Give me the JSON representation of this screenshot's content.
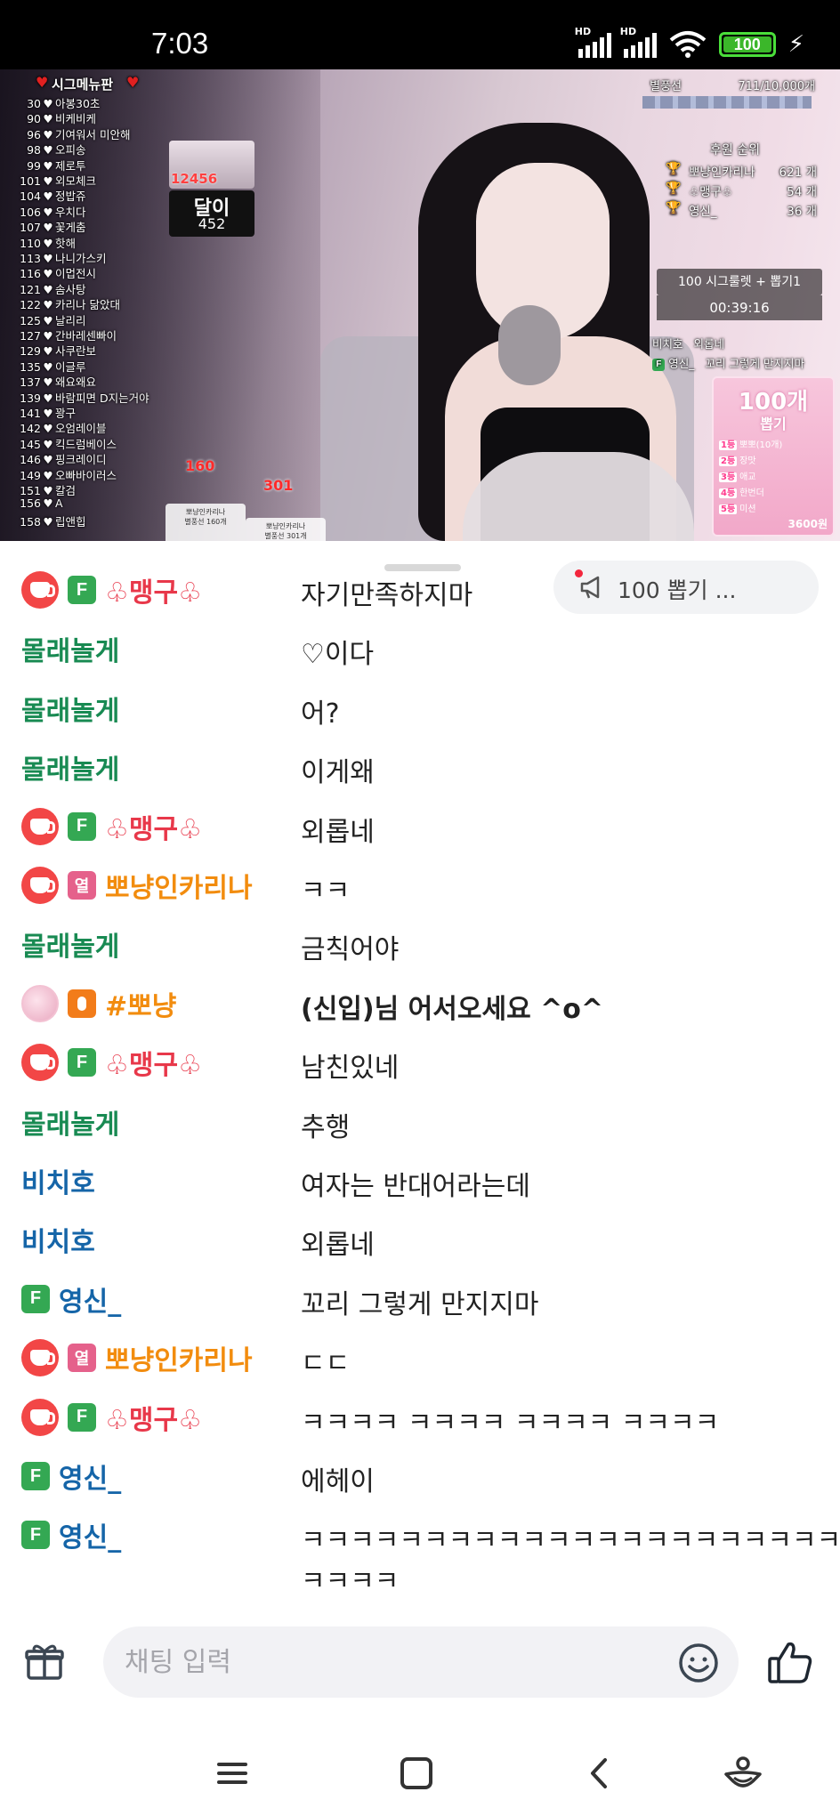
{
  "status_bar": {
    "time": "7:03",
    "hd1": "HD",
    "hd2": "HD",
    "battery": "100"
  },
  "video": {
    "sig_menu_title": "시그메뉴판",
    "sig_items": [
      {
        "num": "30",
        "name": "아봉30초"
      },
      {
        "num": "90",
        "name": "비케비케"
      },
      {
        "num": "96",
        "name": "기여워서 미안해"
      },
      {
        "num": "98",
        "name": "오피송"
      },
      {
        "num": "99",
        "name": "제로투"
      },
      {
        "num": "101",
        "name": "외모체크"
      },
      {
        "num": "104",
        "name": "정밥쥬"
      },
      {
        "num": "106",
        "name": "우치다"
      },
      {
        "num": "107",
        "name": "꽃게춤"
      },
      {
        "num": "110",
        "name": "핫해"
      },
      {
        "num": "113",
        "name": "나니가스키"
      },
      {
        "num": "116",
        "name": "이멉전시"
      },
      {
        "num": "121",
        "name": "솜사탕"
      },
      {
        "num": "122",
        "name": "카리나 닮았대"
      },
      {
        "num": "125",
        "name": "날리리"
      },
      {
        "num": "127",
        "name": "간바레센빠이"
      },
      {
        "num": "129",
        "name": "사쿠란보"
      },
      {
        "num": "135",
        "name": "이글루"
      },
      {
        "num": "137",
        "name": "왜요왜요"
      },
      {
        "num": "139",
        "name": "바람피면 D지는거야"
      },
      {
        "num": "141",
        "name": "꽝구"
      },
      {
        "num": "142",
        "name": "오엄레이블"
      },
      {
        "num": "145",
        "name": "킥드럼베이스"
      },
      {
        "num": "146",
        "name": "핑크레이디"
      },
      {
        "num": "149",
        "name": "오빠바이러스"
      },
      {
        "num": "151",
        "name": "칼검"
      },
      {
        "num": "156",
        "name": "A"
      },
      {
        "num": "158",
        "name": "립앤힙"
      }
    ],
    "promo1_count": "12456",
    "promo2_title": "달이",
    "promo2_count": "452",
    "sticker1_value": "160",
    "sticker2_value": "301",
    "sticker1_caption_top": "뽀냥인카리나",
    "sticker1_caption_bottom": "별풍선 160개",
    "sticker2_caption_top": "뽀냥인카리나",
    "sticker2_caption_bottom": "별풍선 301개",
    "star_balloon_label": "별풍선",
    "star_balloon_progress": "711/10,000개",
    "rank_title": "후원 순위",
    "rank": [
      {
        "name": "뽀냥인카리나",
        "count": "621 개"
      },
      {
        "name": "♧맹구♧",
        "count": "54 개"
      },
      {
        "name": "영신_",
        "count": "36 개"
      }
    ],
    "roulette_label": "100 시그룰렛 + 뽑기1",
    "timer": "00:39:16",
    "mini_chat_1_user": "비치호",
    "mini_chat_1_text": "외롭네",
    "mini_chat_2_user": "영신_",
    "mini_chat_2_text": "꼬리 그렇게 만지지마",
    "box100_title": "100개",
    "box100_subtitle": "뽑기",
    "box100_rows": [
      {
        "rank": "1등",
        "text": "뽀뽀(10개)"
      },
      {
        "rank": "2등",
        "text": "장맛"
      },
      {
        "rank": "3등",
        "text": "애교"
      },
      {
        "rank": "4등",
        "text": "한번더"
      },
      {
        "rank": "5등",
        "text": "미션"
      }
    ],
    "box100_foot": "3600원"
  },
  "notice": {
    "text": "100 뽑기 ..."
  },
  "chat": [
    {
      "badges": [
        "cup",
        "F"
      ],
      "nick": "♧맹구♧",
      "color": "red",
      "text": "자기만족하지마"
    },
    {
      "badges": [],
      "nick": "몰래놀게",
      "color": "green",
      "text": "♡이다"
    },
    {
      "badges": [],
      "nick": "몰래놀게",
      "color": "green",
      "text": "어?"
    },
    {
      "badges": [],
      "nick": "몰래놀게",
      "color": "green",
      "text": "이게왜"
    },
    {
      "badges": [
        "cup",
        "F"
      ],
      "nick": "♧맹구♧",
      "color": "red",
      "text": "외롭네"
    },
    {
      "badges": [
        "cup",
        "열"
      ],
      "nick": "뽀냥인카리나",
      "color": "orange",
      "text": "ㅋㅋ"
    },
    {
      "badges": [],
      "nick": "몰래놀게",
      "color": "green",
      "text": "금칙어야"
    },
    {
      "badges": [
        "avatar",
        "mic"
      ],
      "nick": "#뽀냥",
      "color": "orange",
      "text": "(신입)님 어서오세요 ^o^",
      "bold": true
    },
    {
      "badges": [
        "cup",
        "F"
      ],
      "nick": "♧맹구♧",
      "color": "red",
      "text": "남친있네"
    },
    {
      "badges": [],
      "nick": "몰래놀게",
      "color": "green",
      "text": "추행"
    },
    {
      "badges": [],
      "nick": "비치호",
      "color": "blue",
      "text": "여자는 반대어라는데"
    },
    {
      "badges": [],
      "nick": "비치호",
      "color": "blue",
      "text": "외롭네"
    },
    {
      "badges": [
        "F"
      ],
      "nick": "영신_",
      "color": "blue",
      "text": "꼬리 그렇게 만지지마"
    },
    {
      "badges": [
        "cup",
        "열"
      ],
      "nick": "뽀냥인카리나",
      "color": "orange",
      "text": "ㄷㄷ"
    },
    {
      "badges": [
        "cup",
        "F"
      ],
      "nick": "♧맹구♧",
      "color": "red",
      "text": "ㅋㅋㅋㅋ ㅋㅋㅋㅋ ㅋㅋㅋㅋ ㅋㅋㅋㅋ"
    },
    {
      "badges": [
        "F"
      ],
      "nick": "영신_",
      "color": "blue",
      "text": "에헤이"
    },
    {
      "badges": [
        "F"
      ],
      "nick": "영신_",
      "color": "blue",
      "text": "ㅋㅋㅋㅋㅋㅋㅋㅋㅋㅋㅋㅋㅋㅋㅋㅋㅋㅋㅋㅋㅋㅋㅋ",
      "text2": "ㅋㅋㅋㅋ"
    }
  ],
  "input": {
    "placeholder": "채팅 입력"
  },
  "icons": {
    "gift": "gift-icon",
    "emoji": "emoji-icon",
    "like": "thumbs-up-icon",
    "nav_menu": "menu-icon",
    "nav_home": "home-icon",
    "nav_back": "back-icon",
    "nav_assist": "assistant-icon"
  },
  "colors": {
    "green": "#188a52",
    "red": "#e8384a",
    "orange": "#f28c0e",
    "blue": "#1565a8"
  }
}
